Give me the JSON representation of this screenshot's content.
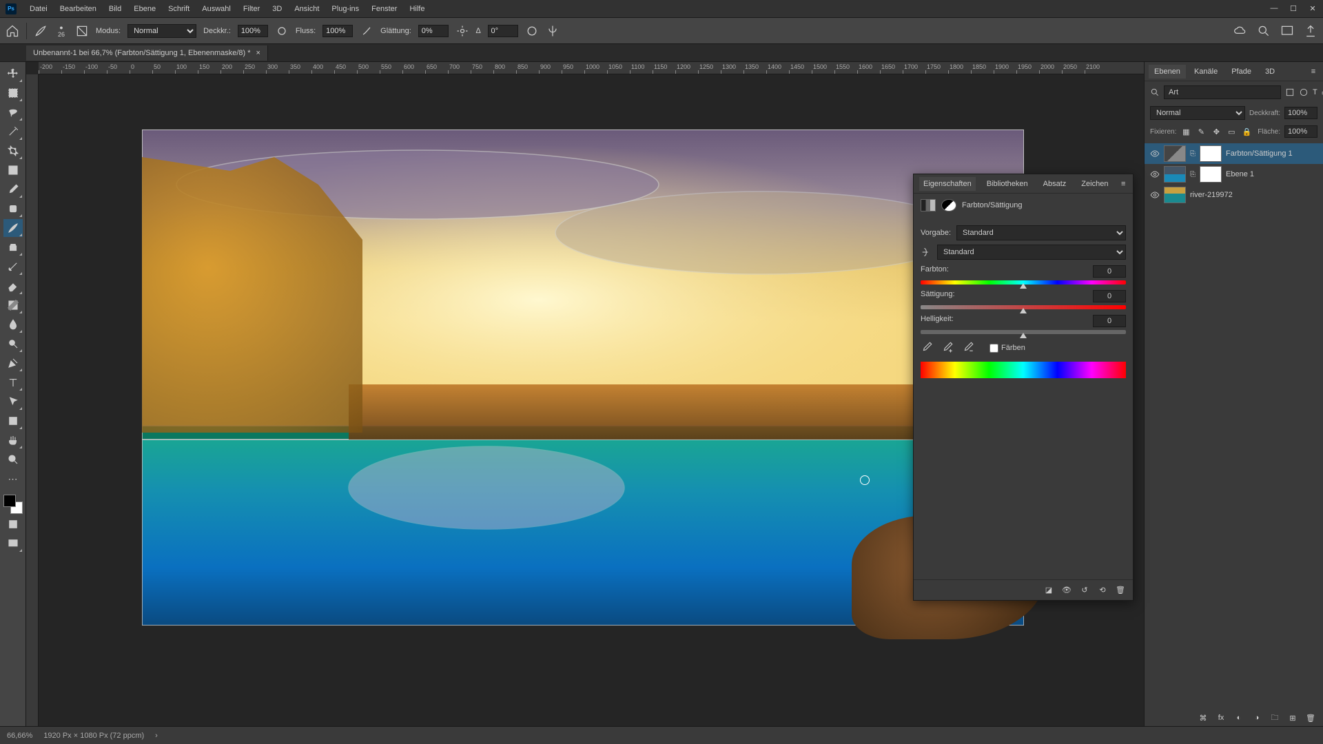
{
  "app_logo": "Ps",
  "menu": [
    "Datei",
    "Bearbeiten",
    "Bild",
    "Ebene",
    "Schrift",
    "Auswahl",
    "Filter",
    "3D",
    "Ansicht",
    "Plug-ins",
    "Fenster",
    "Hilfe"
  ],
  "options": {
    "brush_size": "26",
    "mode_label": "Modus:",
    "mode_value": "Normal",
    "opacity_label": "Deckkr.:",
    "opacity_value": "100%",
    "flow_label": "Fluss:",
    "flow_value": "100%",
    "smooth_label": "Glättung:",
    "smooth_value": "0%",
    "angle_icon": "∆",
    "angle_value": "0°"
  },
  "document": {
    "tab_title": "Unbenannt-1 bei 66,7% (Farbton/Sättigung 1, Ebenenmaske/8) *"
  },
  "ruler_marks": [
    "-200",
    "-150",
    "-100",
    "-50",
    "0",
    "50",
    "100",
    "150",
    "200",
    "250",
    "300",
    "350",
    "400",
    "450",
    "500",
    "550",
    "600",
    "650",
    "700",
    "750",
    "800",
    "850",
    "900",
    "950",
    "1000",
    "1050",
    "1100",
    "1150",
    "1200",
    "1250",
    "1300",
    "1350",
    "1400",
    "1450",
    "1500",
    "1550",
    "1600",
    "1650",
    "1700",
    "1750",
    "1800",
    "1850",
    "1900",
    "1950",
    "2000",
    "2050",
    "2100"
  ],
  "props": {
    "tabs": [
      "Eigenschaften",
      "Bibliotheken",
      "Absatz",
      "Zeichen"
    ],
    "title": "Farbton/Sättigung",
    "preset_label": "Vorgabe:",
    "preset_value": "Standard",
    "channel_value": "Standard",
    "hue_label": "Farbton:",
    "hue_value": "0",
    "sat_label": "Sättigung:",
    "sat_value": "0",
    "lit_label": "Helligkeit:",
    "lit_value": "0",
    "colorize_label": "Färben"
  },
  "right": {
    "tabs": [
      "Ebenen",
      "Kanäle",
      "Pfade",
      "3D"
    ],
    "search_placeholder": "Art",
    "blend_value": "Normal",
    "opacity_label": "Deckkraft:",
    "opacity_value": "100%",
    "lock_label": "Fixieren:",
    "fill_label": "Fläche:",
    "fill_value": "100%",
    "layers": [
      {
        "name": "Farbton/Sättigung 1",
        "selected": true,
        "type": "adj"
      },
      {
        "name": "Ebene 1",
        "selected": false,
        "type": "sky"
      },
      {
        "name": "river-219972",
        "selected": false,
        "type": "river"
      }
    ]
  },
  "status": {
    "zoom": "66,66%",
    "info": "1920 Px × 1080 Px (72 ppcm)",
    "arrow": "›"
  }
}
